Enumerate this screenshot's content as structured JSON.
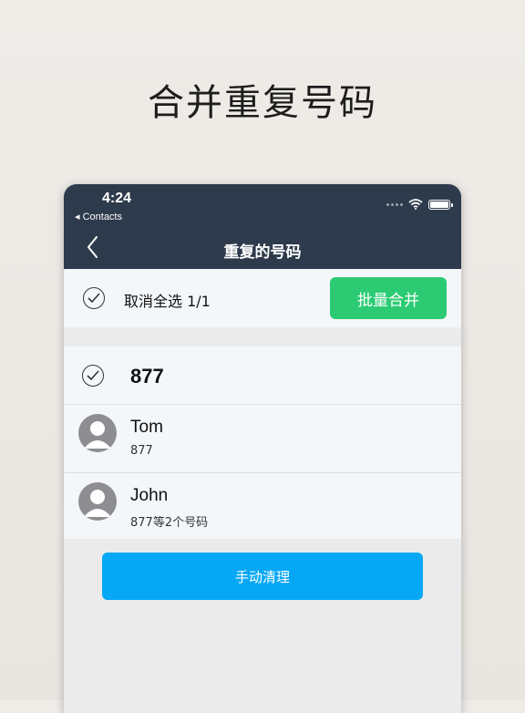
{
  "headline": "合并重复号码",
  "status_bar": {
    "time": "4:24",
    "back_app": "◂ Contacts"
  },
  "nav": {
    "title": "重复的号码"
  },
  "toolbar": {
    "select_label": "取消全选 1/1",
    "merge_label": "批量合并"
  },
  "group": {
    "number": "877",
    "contacts": [
      {
        "name": "Tom",
        "sub": "877"
      },
      {
        "name": "John",
        "sub": "877等2个号码"
      }
    ]
  },
  "actions": {
    "clean_label": "手动清理"
  },
  "colors": {
    "navbar": "#2e3b4c",
    "merge_button": "#2ccb73",
    "clean_button": "#06a8f5",
    "list_bg": "#f4f7fa"
  },
  "icons": [
    "back-chevron-icon",
    "check-icon",
    "wifi-icon",
    "battery-icon",
    "signal-dots-icon",
    "avatar-icon"
  ]
}
